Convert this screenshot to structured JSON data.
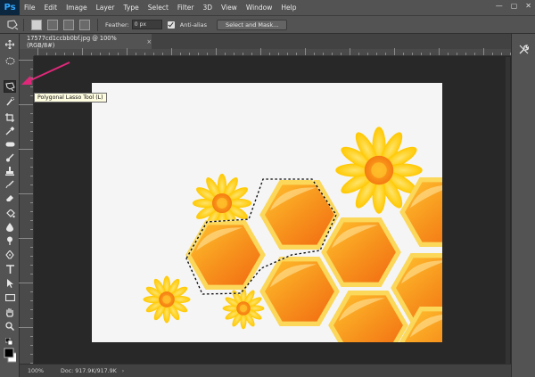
{
  "app": {
    "logo": "Ps"
  },
  "menu": [
    "File",
    "Edit",
    "Image",
    "Layer",
    "Type",
    "Select",
    "Filter",
    "3D",
    "View",
    "Window",
    "Help"
  ],
  "window_controls": {
    "minimize": "—",
    "maximize": "▢",
    "close": "✕"
  },
  "options": {
    "feather_label": "Feather:",
    "feather_value": "0 px",
    "antialias_label": "Anti-alias",
    "select_mask_label": "Select and Mask..."
  },
  "document": {
    "tab_title": "17577cd1ccbb0bf.jpg @ 100% (RGB/8#)",
    "tab_close": "×"
  },
  "tooltip": "Polygonal Lasso Tool (L)",
  "status": {
    "zoom": "100%",
    "doc_size": "Doc: 917.9K/917.9K",
    "arrow": "›"
  },
  "icons": {
    "tools": [
      "move-icon",
      "elliptical-marquee-icon",
      "polygonal-lasso-icon",
      "quick-selection-icon",
      "crop-icon",
      "eyedropper-icon",
      "healing-brush-icon",
      "brush-icon",
      "clone-stamp-icon",
      "history-brush-icon",
      "eraser-icon",
      "paint-bucket-icon",
      "blur-icon",
      "dodge-icon",
      "pen-icon",
      "type-icon",
      "path-selection-icon",
      "rectangle-icon",
      "hand-icon",
      "zoom-icon",
      "default-colors-icon",
      "foreground-background-color-icon"
    ]
  },
  "colors": {
    "ui_panel": "#535353",
    "canvas_bg": "#282828",
    "doc_bg": "#f5f5f5",
    "accent_pink": "#e0287a",
    "honey_orange": "#f7941d",
    "flower_yellow": "#ffd200"
  }
}
